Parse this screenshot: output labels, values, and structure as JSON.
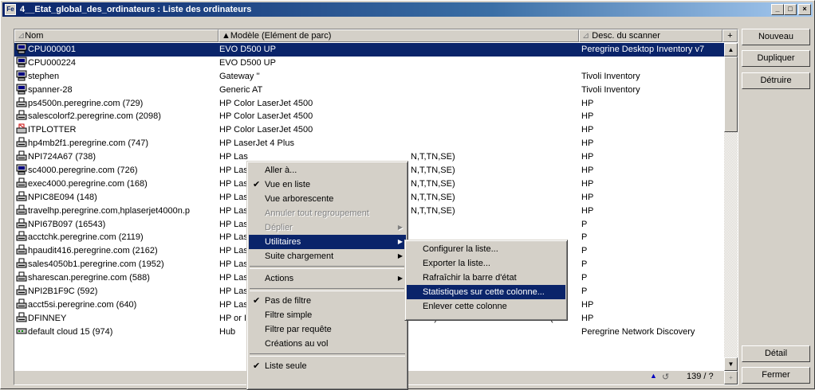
{
  "window": {
    "title": "4__Etat_global_des_ordinateurs : Liste des ordinateurs",
    "controls": [
      "_",
      "□",
      "×"
    ]
  },
  "columns": [
    "Nom",
    "▲Modèle (Elément de parc)",
    "Desc. du scanner",
    "+"
  ],
  "rows": [
    {
      "name": "CPU000001",
      "model": "EVO D500 UP",
      "desc": "Peregrine Desktop Inventory v7",
      "icon": "computer-icon",
      "selected": true
    },
    {
      "name": "CPU000224",
      "model": "EVO D500 UP",
      "desc": "",
      "icon": "computer-icon"
    },
    {
      "name": "stephen",
      "model": "Gateway ''",
      "desc": "Tivoli Inventory",
      "icon": "computer-icon"
    },
    {
      "name": "spanner-28",
      "model": "Generic AT",
      "desc": "Tivoli Inventory",
      "icon": "computer-icon"
    },
    {
      "name": "ps4500n.peregrine.com (729)",
      "model": "HP Color LaserJet 4500",
      "desc": "HP",
      "icon": "printer-icon"
    },
    {
      "name": "salescolorf2.peregrine.com (2098)",
      "model": "HP Color LaserJet 4500",
      "desc": "HP",
      "icon": "printer-icon"
    },
    {
      "name": "ITPLOTTER",
      "model": "HP Color LaserJet 4500",
      "desc": "HP",
      "icon": "plotter-icon"
    },
    {
      "name": "hp4mb2f1.peregrine.com (747)",
      "model": "HP LaserJet 4 Plus",
      "desc": "HP",
      "icon": "printer-icon"
    },
    {
      "name": "NPI724A67 (738)",
      "model": "HP Las",
      "model_tail": "N,T,TN,SE)",
      "desc": "HP",
      "icon": "printer-icon"
    },
    {
      "name": "sc4000.peregrine.com (726)",
      "model": "HP Las",
      "model_tail": "N,T,TN,SE)",
      "desc": "HP",
      "icon": "computer-icon"
    },
    {
      "name": "exec4000.peregrine.com (168)",
      "model": "HP Las",
      "model_tail": "N,T,TN,SE)",
      "desc": "HP",
      "icon": "printer-icon"
    },
    {
      "name": "NPIC8E094 (148)",
      "model": "HP Las",
      "model_tail": "N,T,TN,SE)",
      "desc": "HP",
      "icon": "printer-icon"
    },
    {
      "name": "travelhp.peregrine.com,hplaserjet4000n.p",
      "model": "HP Las",
      "model_tail": "N,T,TN,SE)",
      "desc": "HP",
      "icon": "printer-icon"
    },
    {
      "name": "NPI67B097 (16543)",
      "model": "HP Las",
      "desc": "P",
      "icon": "printer-icon"
    },
    {
      "name": "acctchk.peregrine.com (2119)",
      "model": "HP Las",
      "desc": "P",
      "icon": "printer-icon"
    },
    {
      "name": "hpaudit416.peregrine.com (2162)",
      "model": "HP Las",
      "desc": "P",
      "icon": "printer-icon"
    },
    {
      "name": "sales4050b1.peregrine.com (1952)",
      "model": "HP Las",
      "desc": "P",
      "icon": "printer-icon"
    },
    {
      "name": "sharescan.peregrine.com (588)",
      "model": "HP Las",
      "desc": "P",
      "icon": "printer-icon"
    },
    {
      "name": "NPI2B1F9C (592)",
      "model": "HP Las",
      "desc": "P",
      "icon": "printer-icon"
    },
    {
      "name": "acct5si.peregrine.com (640)",
      "model": "HP Las",
      "desc": "HP",
      "icon": "printer-icon"
    },
    {
      "name": "DFINNEY",
      "model": "HP or I",
      "model_tail": "ntified) with J2552B JetDirect 400N (M",
      "desc": "HP",
      "icon": "printer-icon"
    },
    {
      "name": "default cloud 15 (974)",
      "model": "Hub",
      "desc": "Peregrine Network Discovery",
      "icon": "hub-icon"
    }
  ],
  "status": {
    "count": "139 / ?"
  },
  "buttons": {
    "new": "Nouveau",
    "duplicate": "Dupliquer",
    "delete": "Détruire",
    "detail": "Détail",
    "close": "Fermer"
  },
  "context_menu": [
    {
      "label": "Aller à...",
      "check": false
    },
    {
      "label": "Vue en liste",
      "check": true
    },
    {
      "label": "Vue arborescente",
      "check": false
    },
    {
      "label": "Annuler tout regroupement",
      "disabled": true
    },
    {
      "label": "Déplier",
      "disabled": true,
      "submenu": true
    },
    {
      "label": "Utilitaires",
      "highlighted": true,
      "submenu": true
    },
    {
      "label": "Suite chargement",
      "submenu": true
    },
    {
      "sep": true
    },
    {
      "label": "Actions",
      "submenu": true
    },
    {
      "sep": true
    },
    {
      "label": "Pas de filtre",
      "check": true
    },
    {
      "label": "Filtre simple"
    },
    {
      "label": "Filtre par requête"
    },
    {
      "label": "Créations au vol"
    },
    {
      "sep": true
    },
    {
      "label": "Liste seule",
      "check": true
    }
  ],
  "submenu": [
    {
      "label": "Configurer la liste..."
    },
    {
      "label": "Exporter la liste..."
    },
    {
      "label": "Rafraîchir la barre d'état"
    },
    {
      "label": "Statistiques sur cette colonne...",
      "highlighted": true
    },
    {
      "label": "Enlever cette colonne"
    }
  ],
  "colors": {
    "title_start": "#0a246a",
    "title_end": "#a6caf0",
    "selection": "#0a246a",
    "face": "#d4d0c8"
  }
}
